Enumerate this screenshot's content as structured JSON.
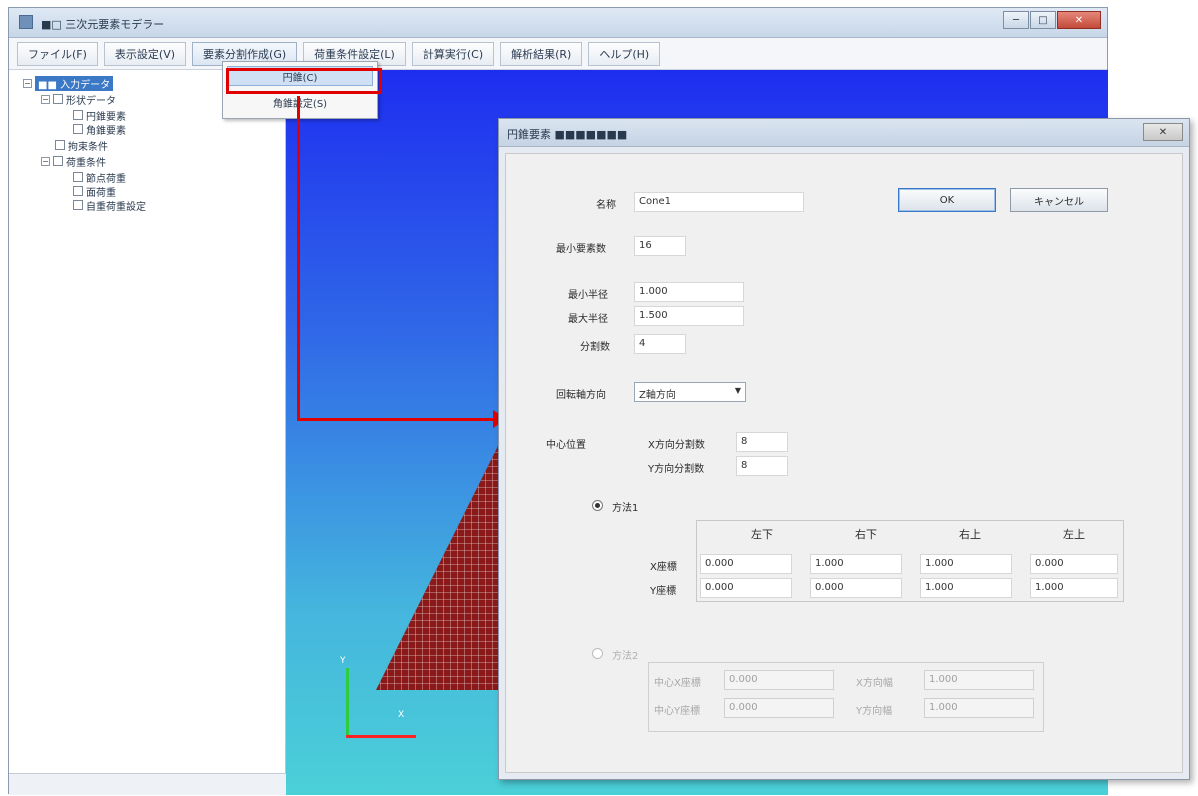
{
  "window": {
    "title": "■□ 三次元要素モデラー",
    "controls": {
      "minimize": "─",
      "maximize": "□",
      "close": "✕"
    }
  },
  "menubar": {
    "items": [
      {
        "label": "ファイル(F)"
      },
      {
        "label": "表示設定(V)"
      },
      {
        "label": "要素分割作成(G)"
      },
      {
        "label": "荷重条件設定(L)"
      },
      {
        "label": "計算実行(C)"
      },
      {
        "label": "解析結果(R)"
      },
      {
        "label": "ヘルプ(H)"
      }
    ]
  },
  "dropdown": {
    "items": [
      {
        "label": "円錐(C)"
      },
      {
        "label": "角錐設定(S)"
      }
    ]
  },
  "tree": {
    "nodes": [
      {
        "label": "■■ 入力データ",
        "selected": true
      },
      {
        "label": "形状データ"
      },
      {
        "label": "円錐要素"
      },
      {
        "label": "角錐要素"
      },
      {
        "label": "拘束条件"
      },
      {
        "label": "荷重条件"
      },
      {
        "label": "節点荷重"
      },
      {
        "label": "面荷重"
      },
      {
        "label": "自重荷重設定"
      }
    ]
  },
  "viewport": {
    "axis_y_label": "Y",
    "axis_x_label": "X"
  },
  "dialog": {
    "title": "円錐要素 ■■■■■■■",
    "close": "✕",
    "name_label": "名称",
    "name_value": "Cone1",
    "ok": "OK",
    "cancel": "キャンセル",
    "min_elements_label": "最小要素数",
    "min_elements_value": "16",
    "min_radius_label": "最小半径",
    "min_radius_value": "1.000",
    "max_radius_label": "最大半径",
    "max_radius_value": "1.500",
    "divisions_label": "分割数",
    "divisions_value": "4",
    "direction_label": "回転軸方向",
    "direction_value": "Z軸方向",
    "position_label": "中心位置",
    "x_coord_label": "X方向分割数",
    "x_coord_value": "8",
    "y_coord_label": "Y方向分割数",
    "y_coord_value": "8",
    "option1_label": "方法1",
    "table": {
      "columns": [
        "左下",
        "右下",
        "右上",
        "左上"
      ],
      "rows": [
        {
          "label": "X座標",
          "values": [
            "0.000",
            "1.000",
            "1.000",
            "0.000"
          ]
        },
        {
          "label": "Y座標",
          "values": [
            "0.000",
            "0.000",
            "1.000",
            "1.000"
          ]
        }
      ]
    },
    "option2_label": "方法2",
    "opt2": {
      "center_x_label": "中心X座標",
      "center_x_value": "0.000",
      "width_label": "X方向幅",
      "width_value": "1.000",
      "center_y_label": "中心Y座標",
      "center_y_value": "0.000",
      "height_label": "Y方向幅",
      "height_value": "1.000"
    }
  },
  "colors": {
    "highlight": "#e00000",
    "viewport_top": "#1e2ef0",
    "viewport_bottom": "#4bd0d8",
    "mesh": "#8a1a1a"
  }
}
